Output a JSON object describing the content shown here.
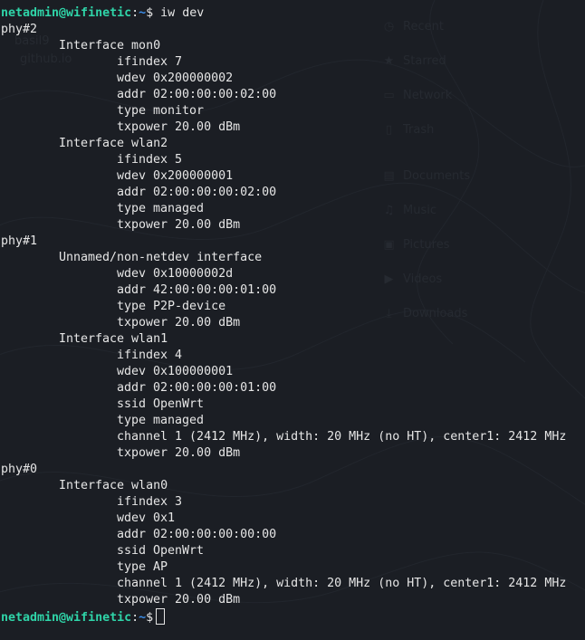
{
  "prompt": {
    "user_host": "netadmin@wifinetic",
    "separator": ":",
    "path": "~",
    "symbol": "$"
  },
  "command": "iw dev",
  "output": [
    {
      "level": 0,
      "text": "phy#2"
    },
    {
      "level": 1,
      "text": "Interface mon0"
    },
    {
      "level": 2,
      "text": "ifindex 7"
    },
    {
      "level": 2,
      "text": "wdev 0x200000002"
    },
    {
      "level": 2,
      "text": "addr 02:00:00:00:02:00"
    },
    {
      "level": 2,
      "text": "type monitor"
    },
    {
      "level": 2,
      "text": "txpower 20.00 dBm"
    },
    {
      "level": 1,
      "text": "Interface wlan2"
    },
    {
      "level": 2,
      "text": "ifindex 5"
    },
    {
      "level": 2,
      "text": "wdev 0x200000001"
    },
    {
      "level": 2,
      "text": "addr 02:00:00:00:02:00"
    },
    {
      "level": 2,
      "text": "type managed"
    },
    {
      "level": 2,
      "text": "txpower 20.00 dBm"
    },
    {
      "level": 0,
      "text": "phy#1"
    },
    {
      "level": 1,
      "text": "Unnamed/non-netdev interface"
    },
    {
      "level": 2,
      "text": "wdev 0x10000002d"
    },
    {
      "level": 2,
      "text": "addr 42:00:00:00:01:00"
    },
    {
      "level": 2,
      "text": "type P2P-device"
    },
    {
      "level": 2,
      "text": "txpower 20.00 dBm"
    },
    {
      "level": 1,
      "text": "Interface wlan1"
    },
    {
      "level": 2,
      "text": "ifindex 4"
    },
    {
      "level": 2,
      "text": "wdev 0x100000001"
    },
    {
      "level": 2,
      "text": "addr 02:00:00:00:01:00"
    },
    {
      "level": 2,
      "text": "ssid OpenWrt"
    },
    {
      "level": 2,
      "text": "type managed"
    },
    {
      "level": 2,
      "text": "channel 1 (2412 MHz), width: 20 MHz (no HT), center1: 2412 MHz"
    },
    {
      "level": 2,
      "text": "txpower 20.00 dBm"
    },
    {
      "level": 0,
      "text": "phy#0"
    },
    {
      "level": 1,
      "text": "Interface wlan0"
    },
    {
      "level": 2,
      "text": "ifindex 3"
    },
    {
      "level": 2,
      "text": "wdev 0x1"
    },
    {
      "level": 2,
      "text": "addr 02:00:00:00:00:00"
    },
    {
      "level": 2,
      "text": "ssid OpenWrt"
    },
    {
      "level": 2,
      "text": "type AP"
    },
    {
      "level": 2,
      "text": "channel 1 (2412 MHz), width: 20 MHz (no HT), center1: 2412 MHz"
    },
    {
      "level": 2,
      "text": "txpower 20.00 dBm"
    }
  ],
  "background_ghost": {
    "desktop_text": [
      "basil9",
      "github.io"
    ],
    "sidebar": [
      {
        "label": "Recent",
        "icon": "clock-icon"
      },
      {
        "label": "Starred",
        "icon": "star-icon"
      },
      {
        "label": "Network",
        "icon": "network-icon"
      },
      {
        "label": "Trash",
        "icon": "trash-icon"
      },
      {
        "label": "Documents",
        "icon": "document-icon"
      },
      {
        "label": "Music",
        "icon": "music-icon"
      },
      {
        "label": "Pictures",
        "icon": "picture-icon"
      },
      {
        "label": "Videos",
        "icon": "video-icon"
      },
      {
        "label": "Downloads",
        "icon": "download-icon"
      }
    ]
  },
  "colors": {
    "background": "#1b1e24",
    "prompt_user": "#2fd4a8",
    "prompt_path": "#3b8eea",
    "text": "#e6e6e6"
  }
}
